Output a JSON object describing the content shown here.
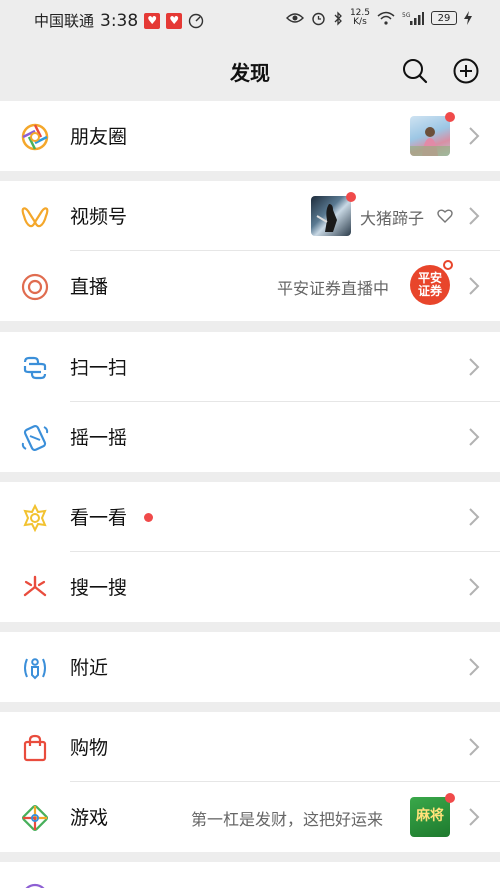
{
  "status_bar": {
    "carrier": "中国联通",
    "time": "3:38",
    "net_speed_value": "12.5",
    "net_speed_unit": "K/s",
    "signal_label": "5G",
    "battery": "29"
  },
  "header": {
    "title": "发现"
  },
  "items": {
    "moments": {
      "label": "朋友圈"
    },
    "channels": {
      "label": "视频号",
      "account": "大猪蹄子"
    },
    "live": {
      "label": "直播",
      "status": "平安证券直播中",
      "logo_line1": "平安",
      "logo_line2": "证券"
    },
    "scan": {
      "label": "扫一扫"
    },
    "shake": {
      "label": "摇一摇"
    },
    "top_stories": {
      "label": "看一看"
    },
    "search": {
      "label": "搜一搜"
    },
    "nearby": {
      "label": "附近"
    },
    "shopping": {
      "label": "购物"
    },
    "games": {
      "label": "游戏",
      "promo": "第一杠是发财，这把好运来",
      "game_icon_text": "麻将"
    }
  },
  "colors": {
    "background": "#ededed",
    "red_dot": "#f04a4a",
    "accent_orange": "#f4a72b"
  }
}
